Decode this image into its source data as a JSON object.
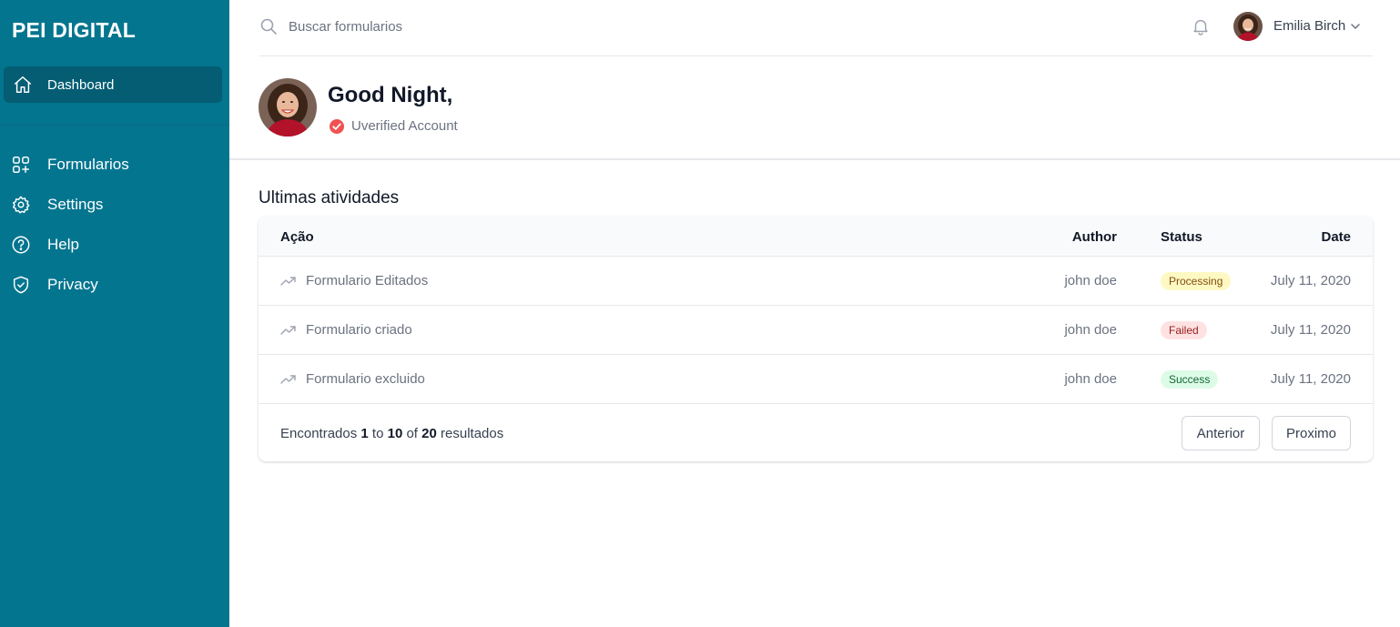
{
  "brand": "PEI DIGITAL",
  "sidebar": {
    "active_item": {
      "label": "Dashboard",
      "icon": "home-icon"
    },
    "items": [
      {
        "label": "Formularios",
        "icon": "grid-add-icon"
      },
      {
        "label": "Settings",
        "icon": "gear-icon"
      },
      {
        "label": "Help",
        "icon": "question-circle-icon"
      },
      {
        "label": "Privacy",
        "icon": "shield-check-icon"
      }
    ]
  },
  "topbar": {
    "search_placeholder": "Buscar formularios",
    "user_name": "Emilia Birch"
  },
  "greeting": {
    "title": "Good Night,",
    "verification": "Uverified Account"
  },
  "activity": {
    "title": "Ultimas atividades",
    "columns": {
      "action": "Ação",
      "author": "Author",
      "status": "Status",
      "date": "Date"
    },
    "rows": [
      {
        "action": "Formulario Editados",
        "author": "john doe",
        "status": "Processing",
        "date": "July 11, 2020"
      },
      {
        "action": "Formulario criado",
        "author": "john doe",
        "status": "Failed",
        "date": "July 11, 2020"
      },
      {
        "action": "Formulario excluido",
        "author": "john doe",
        "status": "Success",
        "date": "July 11, 2020"
      }
    ],
    "footer": {
      "prefix": "Encontrados",
      "from": "1",
      "to_word": "to",
      "to": "10",
      "of_word": "of",
      "total": "20",
      "suffix": "resultados"
    },
    "prev_label": "Anterior",
    "next_label": "Proximo"
  },
  "colors": {
    "sidebar_bg": "#03758f",
    "sidebar_active_bg": "#045d73",
    "badge_processing": "#fef9c3",
    "badge_failed": "#fee2e2",
    "badge_success": "#dcfce7",
    "verified_check": "#f05252"
  }
}
